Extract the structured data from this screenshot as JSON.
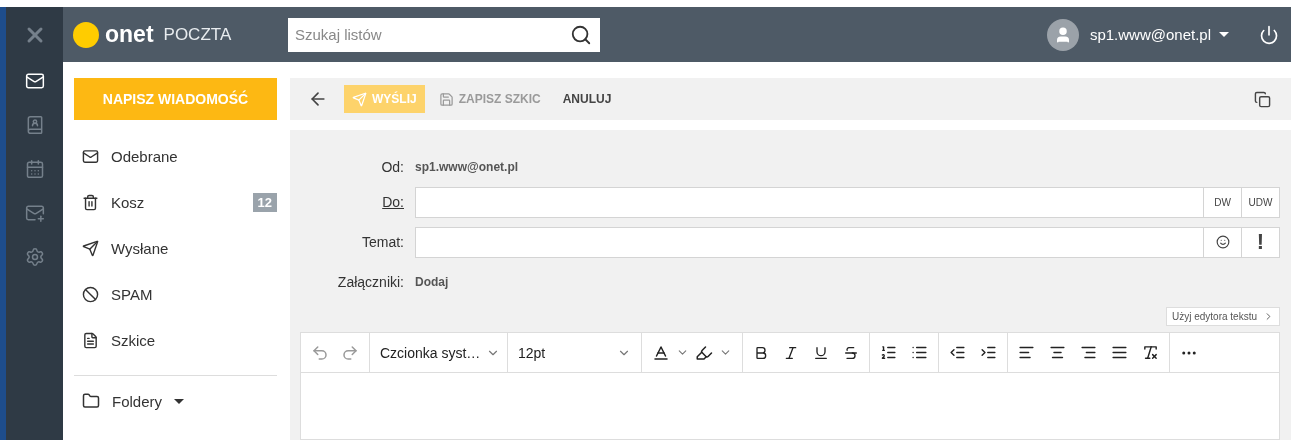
{
  "rail": {
    "items": [
      {
        "selected": false
      },
      {
        "selected": true
      },
      {
        "selected": false
      },
      {
        "selected": false
      },
      {
        "selected": false
      },
      {
        "selected": false
      }
    ]
  },
  "header": {
    "logo": {
      "brand": "onet",
      "product": "POCZTA"
    },
    "search": {
      "placeholder": "Szukaj listów"
    },
    "user": {
      "email": "sp1.www@onet.pl"
    }
  },
  "sidebar": {
    "compose": "NAPISZ WIADOMOŚĆ",
    "items": [
      {
        "label": "Odebrane"
      },
      {
        "label": "Kosz",
        "badge": "12"
      },
      {
        "label": "Wysłane"
      },
      {
        "label": "SPAM"
      },
      {
        "label": "Szkice"
      }
    ],
    "folders": "Foldery"
  },
  "toolbar": {
    "actions": [
      {
        "label": "WYŚLIJ",
        "kind": "send",
        "disabled": false
      },
      {
        "label": "ZAPISZ SZKIC",
        "kind": "save",
        "disabled": true
      },
      {
        "label": "ANULUJ",
        "kind": "plain",
        "disabled": false
      }
    ]
  },
  "form": {
    "from_label": "Od:",
    "from_value": "sp1.www@onet.pl",
    "to_label": "Do:",
    "cc": "DW",
    "bcc": "UDW",
    "subject_label": "Temat:",
    "priority": "!",
    "attachments_label": "Załączniki:",
    "attachments_action": "Dodaj"
  },
  "editor": {
    "switch": "Użyj edytora tekstu",
    "font": "Czcionka syst…",
    "size": "12pt"
  }
}
